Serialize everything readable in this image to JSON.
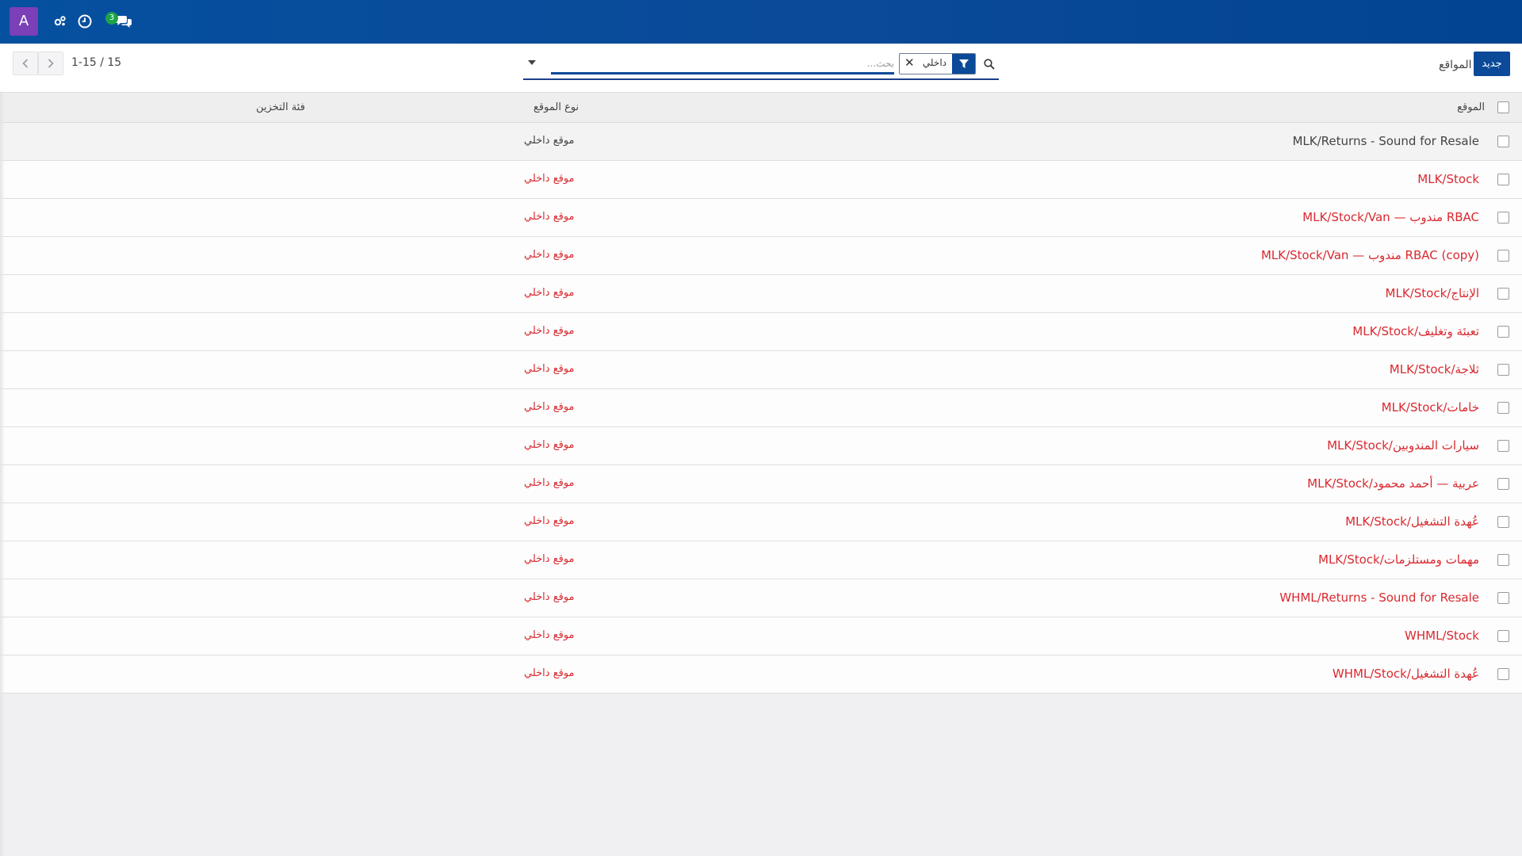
{
  "navbar": {
    "avatar_letter": "A",
    "icons": [
      "activity-icon",
      "clock-icon",
      "chat-icon"
    ],
    "chat_badge": "3",
    "brand_color": "#0a4a98"
  },
  "control": {
    "new_button": "جديد",
    "breadcrumb": "المواقع",
    "search": {
      "placeholder": "بحث...",
      "facet_value": "داخلي"
    },
    "pager": {
      "value": "1-15 / 15"
    }
  },
  "table": {
    "headers": {
      "location": "الموقع",
      "location_type": "نوع الموقع",
      "storage_category": "فئة التخزين"
    },
    "rows": [
      {
        "name": "MLK/Returns - Sound for Resale",
        "type": "موقع داخلي"
      },
      {
        "name": "MLK/Stock",
        "type": "موقع داخلي"
      },
      {
        "name": "MLK/Stock/Van — مندوب RBAC",
        "type": "موقع داخلي"
      },
      {
        "name": "MLK/Stock/Van — مندوب RBAC (copy)",
        "type": "موقع داخلي"
      },
      {
        "name": "MLK/Stock/الإنتاج",
        "type": "موقع داخلي"
      },
      {
        "name": "MLK/Stock/تعبئة وتغليف",
        "type": "موقع داخلي"
      },
      {
        "name": "MLK/Stock/ثلاجة",
        "type": "موقع داخلي"
      },
      {
        "name": "MLK/Stock/خامات",
        "type": "موقع داخلي"
      },
      {
        "name": "MLK/Stock/سيارات المندوبين",
        "type": "موقع داخلي"
      },
      {
        "name": "MLK/Stock/عربية — أحمد محمود",
        "type": "موقع داخلي"
      },
      {
        "name": "MLK/Stock/عُهدة التشغيل",
        "type": "موقع داخلي"
      },
      {
        "name": "MLK/Stock/مهمات ومستلزمات",
        "type": "موقع داخلي"
      },
      {
        "name": "WHML/Returns - Sound for Resale",
        "type": "موقع داخلي"
      },
      {
        "name": "WHML/Stock",
        "type": "موقع داخلي"
      },
      {
        "name": "WHML/Stock/عُهدة التشغيل",
        "type": "موقع داخلي"
      }
    ]
  }
}
